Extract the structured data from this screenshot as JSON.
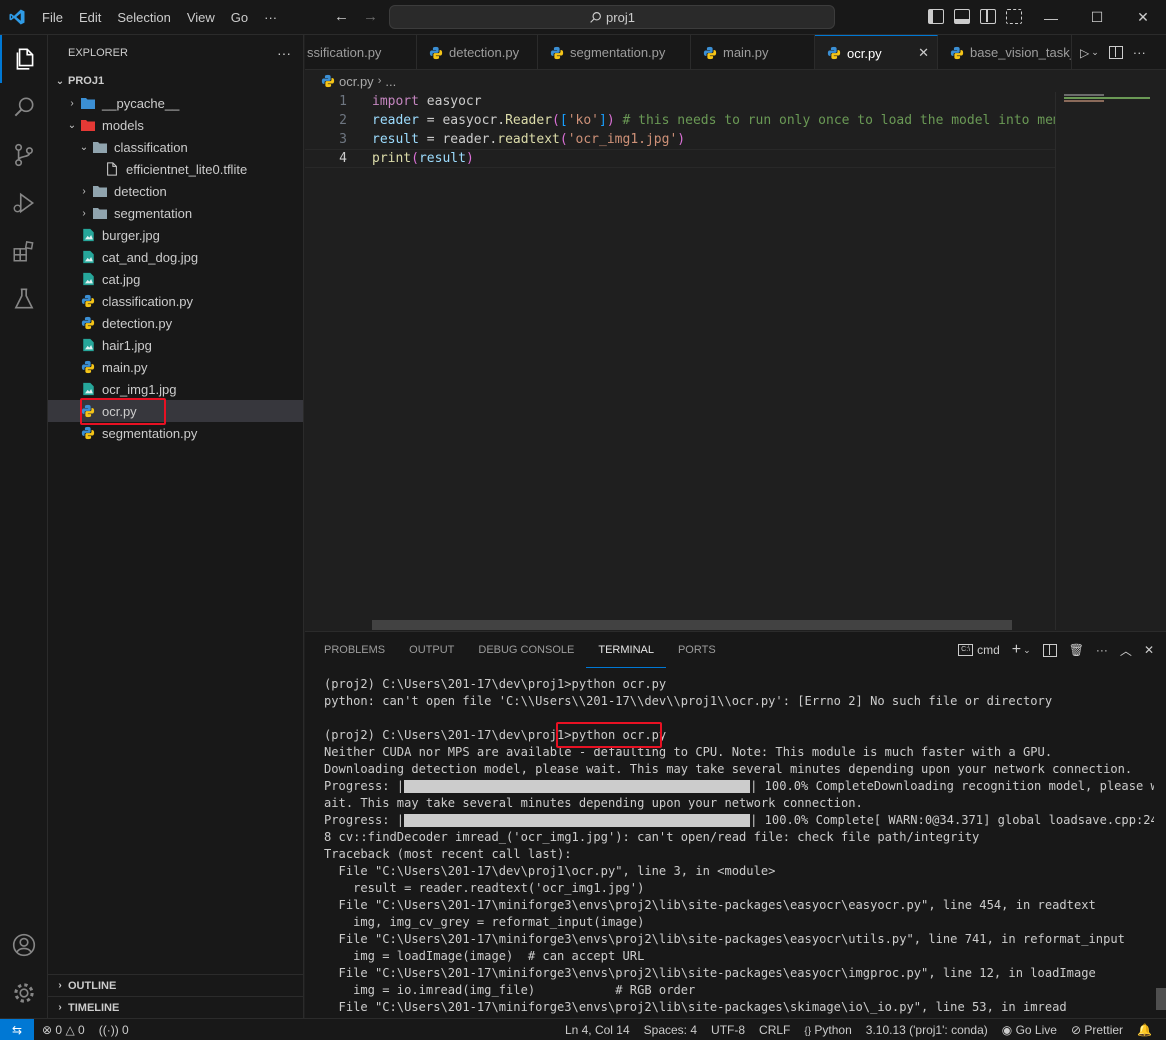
{
  "window": {
    "menu": [
      "File",
      "Edit",
      "Selection",
      "View",
      "Go",
      "···"
    ],
    "search_text": "proj1",
    "min": "—",
    "max": "☐",
    "close": "✕"
  },
  "explorer": {
    "title": "EXPLORER",
    "more": "···",
    "root": "PROJ1",
    "items": [
      {
        "label": "__pycache__",
        "depth": 1,
        "type": "folder",
        "expanded": false
      },
      {
        "label": "models",
        "depth": 1,
        "type": "folder",
        "expanded": true
      },
      {
        "label": "classification",
        "depth": 2,
        "type": "folder",
        "expanded": true
      },
      {
        "label": "efficientnet_lite0.tflite",
        "depth": 3,
        "type": "file"
      },
      {
        "label": "detection",
        "depth": 2,
        "type": "folder",
        "expanded": false
      },
      {
        "label": "segmentation",
        "depth": 2,
        "type": "folder",
        "expanded": false
      },
      {
        "label": "burger.jpg",
        "depth": 1,
        "type": "image"
      },
      {
        "label": "cat_and_dog.jpg",
        "depth": 1,
        "type": "image"
      },
      {
        "label": "cat.jpg",
        "depth": 1,
        "type": "image"
      },
      {
        "label": "classification.py",
        "depth": 1,
        "type": "python"
      },
      {
        "label": "detection.py",
        "depth": 1,
        "type": "python"
      },
      {
        "label": "hair1.jpg",
        "depth": 1,
        "type": "image"
      },
      {
        "label": "main.py",
        "depth": 1,
        "type": "python"
      },
      {
        "label": "ocr_img1.jpg",
        "depth": 1,
        "type": "image"
      },
      {
        "label": "ocr.py",
        "depth": 1,
        "type": "python",
        "selected": true
      },
      {
        "label": "segmentation.py",
        "depth": 1,
        "type": "python"
      }
    ],
    "outline": "OUTLINE",
    "timeline": "TIMELINE"
  },
  "tabs": [
    {
      "label": "ssification.py",
      "active": false
    },
    {
      "label": "detection.py",
      "active": false
    },
    {
      "label": "segmentation.py",
      "active": false
    },
    {
      "label": "main.py",
      "active": false
    },
    {
      "label": "ocr.py",
      "active": true
    },
    {
      "label": "base_vision_task_",
      "active": false
    }
  ],
  "breadcrumb": {
    "file": "ocr.py",
    "rest": "..."
  },
  "editor": {
    "line_numbers": [
      "1",
      "2",
      "3",
      "4"
    ],
    "line1": {
      "kw": "import",
      "mod": " easyocr"
    },
    "line2": {
      "var": "reader",
      "eq": " = ",
      "obj": "easyocr",
      "dot": ".",
      "fn": "Reader",
      "p1": "(",
      "b1": "[",
      "str": "'ko'",
      "b2": "]",
      "p2": ")",
      "cmt": " # this needs to run only once to load the model into memo"
    },
    "line3": {
      "var": "result",
      "eq": " = ",
      "obj": "reader",
      "dot": ".",
      "fn": "readtext",
      "p1": "(",
      "str": "'ocr_img1.jpg'",
      "p2": ")"
    },
    "line4": {
      "fn": "print",
      "p1": "(",
      "arg": "result",
      "p2": ")"
    }
  },
  "panel": {
    "tabs": [
      "PROBLEMS",
      "OUTPUT",
      "DEBUG CONSOLE",
      "TERMINAL",
      "PORTS"
    ],
    "active_tab": "TERMINAL",
    "shell": "cmd"
  },
  "terminal": {
    "lines": [
      "(proj2) C:\\Users\\201-17\\dev\\proj1>python ocr.py",
      "python: can't open file 'C:\\\\Users\\\\201-17\\\\dev\\\\proj1\\\\ocr.py': [Errno 2] No such file or directory",
      "",
      "(proj2) C:\\Users\\201-17\\dev\\proj1>python ocr.py",
      "Neither CUDA nor MPS are available - defaulting to CPU. Note: This module is much faster with a GPU.",
      "Downloading detection model, please wait. This may take several minutes depending upon your network connection."
    ],
    "progress1_prefix": "Progress: |",
    "progress1_suffix": "| 100.0% CompleteDownloading recognition model, please w",
    "line_after1": "ait. This may take several minutes depending upon your network connection.",
    "progress2_prefix": "Progress: |",
    "progress2_suffix": "| 100.0% Complete[ WARN:0@34.371] global loadsave.cpp:24",
    "progress_percent": 100,
    "lines_after": [
      "8 cv::findDecoder imread_('ocr_img1.jpg'): can't open/read file: check file path/integrity",
      "Traceback (most recent call last):",
      "  File \"C:\\Users\\201-17\\dev\\proj1\\ocr.py\", line 3, in <module>",
      "    result = reader.readtext('ocr_img1.jpg')",
      "  File \"C:\\Users\\201-17\\miniforge3\\envs\\proj2\\lib\\site-packages\\easyocr\\easyocr.py\", line 454, in readtext",
      "    img, img_cv_grey = reformat_input(image)",
      "  File \"C:\\Users\\201-17\\miniforge3\\envs\\proj2\\lib\\site-packages\\easyocr\\utils.py\", line 741, in reformat_input",
      "    img = loadImage(image)  # can accept URL",
      "  File \"C:\\Users\\201-17\\miniforge3\\envs\\proj2\\lib\\site-packages\\easyocr\\imgproc.py\", line 12, in loadImage",
      "    img = io.imread(img_file)           # RGB order",
      "  File \"C:\\Users\\201-17\\miniforge3\\envs\\proj2\\lib\\site-packages\\skimage\\io\\_io.py\", line 53, in imread"
    ]
  },
  "status": {
    "remote": "⇆",
    "errors": "0",
    "warnings": "0",
    "ports": "0",
    "position": "Ln 4, Col 14",
    "spaces": "Spaces: 4",
    "encoding": "UTF-8",
    "eol": "CRLF",
    "language": "Python",
    "interpreter": "3.10.13 ('proj1': conda)",
    "golive": "Go Live",
    "prettier": "Prettier"
  },
  "colors": {
    "accent": "#0078d4",
    "highlight_box": "#e81123",
    "python_icon": "#3b8fd4",
    "image_icon": "#26a69a",
    "folder_icon": "#90a4ae"
  }
}
